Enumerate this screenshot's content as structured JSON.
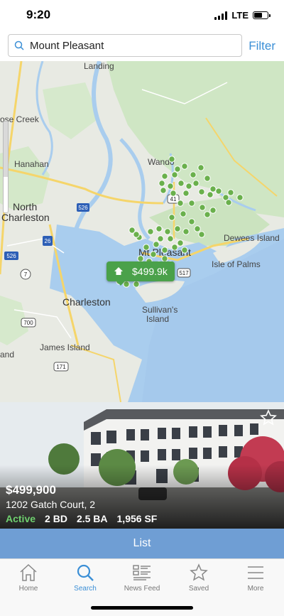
{
  "status_bar": {
    "time": "9:20",
    "network": "LTE"
  },
  "search": {
    "value": "Mount Pleasant",
    "filter_label": "Filter"
  },
  "map": {
    "labels": {
      "landing": "Landing",
      "goose_creek": "ose Creek",
      "hanahan": "Hanahan",
      "north": "North",
      "charleston_north": "Charleston",
      "wando": "Wando",
      "mt_pleasant": "Mt Pleasant",
      "dewees": "Dewees Island",
      "isle_of_palms": "Isle of Palms",
      "charleston": "Charleston",
      "sullivans": "Sullivan's",
      "island": "Island",
      "james_island": "James Island",
      "and": "and"
    },
    "shields": {
      "i526_a": "526",
      "i526_b": "526",
      "i26": "26",
      "r41": "41",
      "r517": "517",
      "r7": "7",
      "r700": "700",
      "r171": "171"
    },
    "price_pin": "$499.9k",
    "marker_color": "#6ab04c"
  },
  "listing": {
    "price": "$499,900",
    "address": "1202 Gatch Court, 2",
    "status": "Active",
    "beds": "2 BD",
    "baths": "2.5 BA",
    "sqft": "1,956 SF"
  },
  "list_button": "List",
  "tabs": [
    {
      "label": "Home",
      "icon": "home-icon"
    },
    {
      "label": "Search",
      "icon": "search-icon"
    },
    {
      "label": "News Feed",
      "icon": "news-feed-icon"
    },
    {
      "label": "Saved",
      "icon": "star-icon"
    },
    {
      "label": "More",
      "icon": "menu-icon"
    }
  ],
  "colors": {
    "accent": "#3b8fd6",
    "list_button": "#6f9ed4",
    "active_status": "#6fd06f",
    "price_pin": "#4aa14a"
  }
}
